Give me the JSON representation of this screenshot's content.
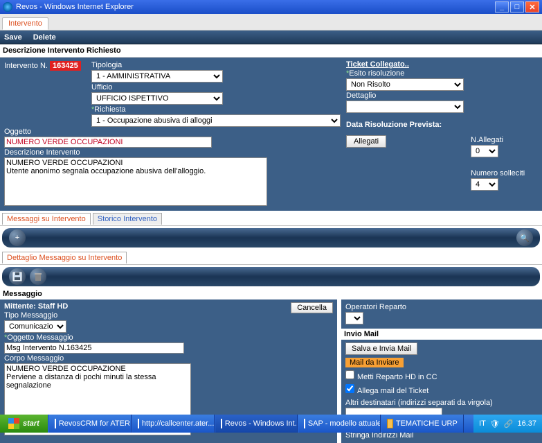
{
  "window": {
    "title": "Revos - Windows Internet Explorer"
  },
  "tab": {
    "label": "Intervento"
  },
  "actions": {
    "save": "Save",
    "delete": "Delete"
  },
  "section": {
    "descrizione": "Descrizione Intervento Richiesto",
    "messaggi_tab": "Messaggi su Intervento",
    "storico_tab": "Storico Intervento",
    "dettaglio": "Dettaglio Messaggio su Intervento",
    "messaggio": "Messaggio",
    "invio_mail": "Invio Mail"
  },
  "intervento": {
    "label_num": "Intervento N.",
    "numero": "163425",
    "tipologia_lbl": "Tipologia",
    "tipologia_val": "1 - AMMINISTRATIVA",
    "ufficio_lbl": "Ufficio",
    "ufficio_val": "UFFICIO ISPETTIVO",
    "richiesta_lbl": "Richiesta",
    "richiesta_val": "1 - Occupazione abusiva di alloggi",
    "oggetto_lbl": "Oggetto",
    "oggetto_val": "NUMERO VERDE OCCUPAZIONI",
    "desc_lbl": "Descrizione Intervento",
    "desc_val": "NUMERO VERDE OCCUPAZIONI\nUtente anonimo segnala occupazione abusiva dell'alloggio."
  },
  "ticket": {
    "collegato_lbl": "Ticket Collegato..",
    "esito_lbl": "Esito risoluzione",
    "esito_val": "Non Risolto",
    "dettaglio_lbl": "Dettaglio",
    "dettaglio_val": "",
    "data_ris_lbl": "Data Risoluzione Prevista:",
    "allegati_btn": "Allegati",
    "n_allegati_lbl": "N.Allegati",
    "n_allegati_val": "0",
    "solleciti_lbl": "Numero solleciti",
    "solleciti_val": "4"
  },
  "msg": {
    "mittente_lbl": "Mittente: Staff HD",
    "cancella": "Cancella",
    "tipo_lbl": "Tipo Messaggio",
    "tipo_val": "Comunicazione",
    "ogg_lbl": "Oggetto Messaggio",
    "ogg_val": "Msg Intervento N.163425",
    "corpo_lbl": "Corpo Messaggio",
    "corpo_val": "NUMERO VERDE OCCUPAZIONE\nPerviene a distanza di pochi minuti la stessa segnalazione"
  },
  "right": {
    "op_rep_lbl": "Operatori Reparto",
    "save_send": "Salva e Invia Mail",
    "mail_da_inviare": "Mail da Inviare",
    "cc_lbl": "Metti Reparto HD in CC",
    "allega_lbl": "Allega mail del Ticket",
    "altri_lbl": "Altri destinatari (indirizzi separati da virgola)",
    "stringa_lbl": "Stringa Indirizzi Mail"
  },
  "taskbar": {
    "start": "start",
    "t1": "RevosCRM for ATER ...",
    "t2": "http://callcenter.ater...",
    "t3": "Revos - Windows Int...",
    "t4": "SAP - modello attuale...",
    "t5": "TEMATICHE URP",
    "lang": "IT",
    "clock": "16.37"
  }
}
